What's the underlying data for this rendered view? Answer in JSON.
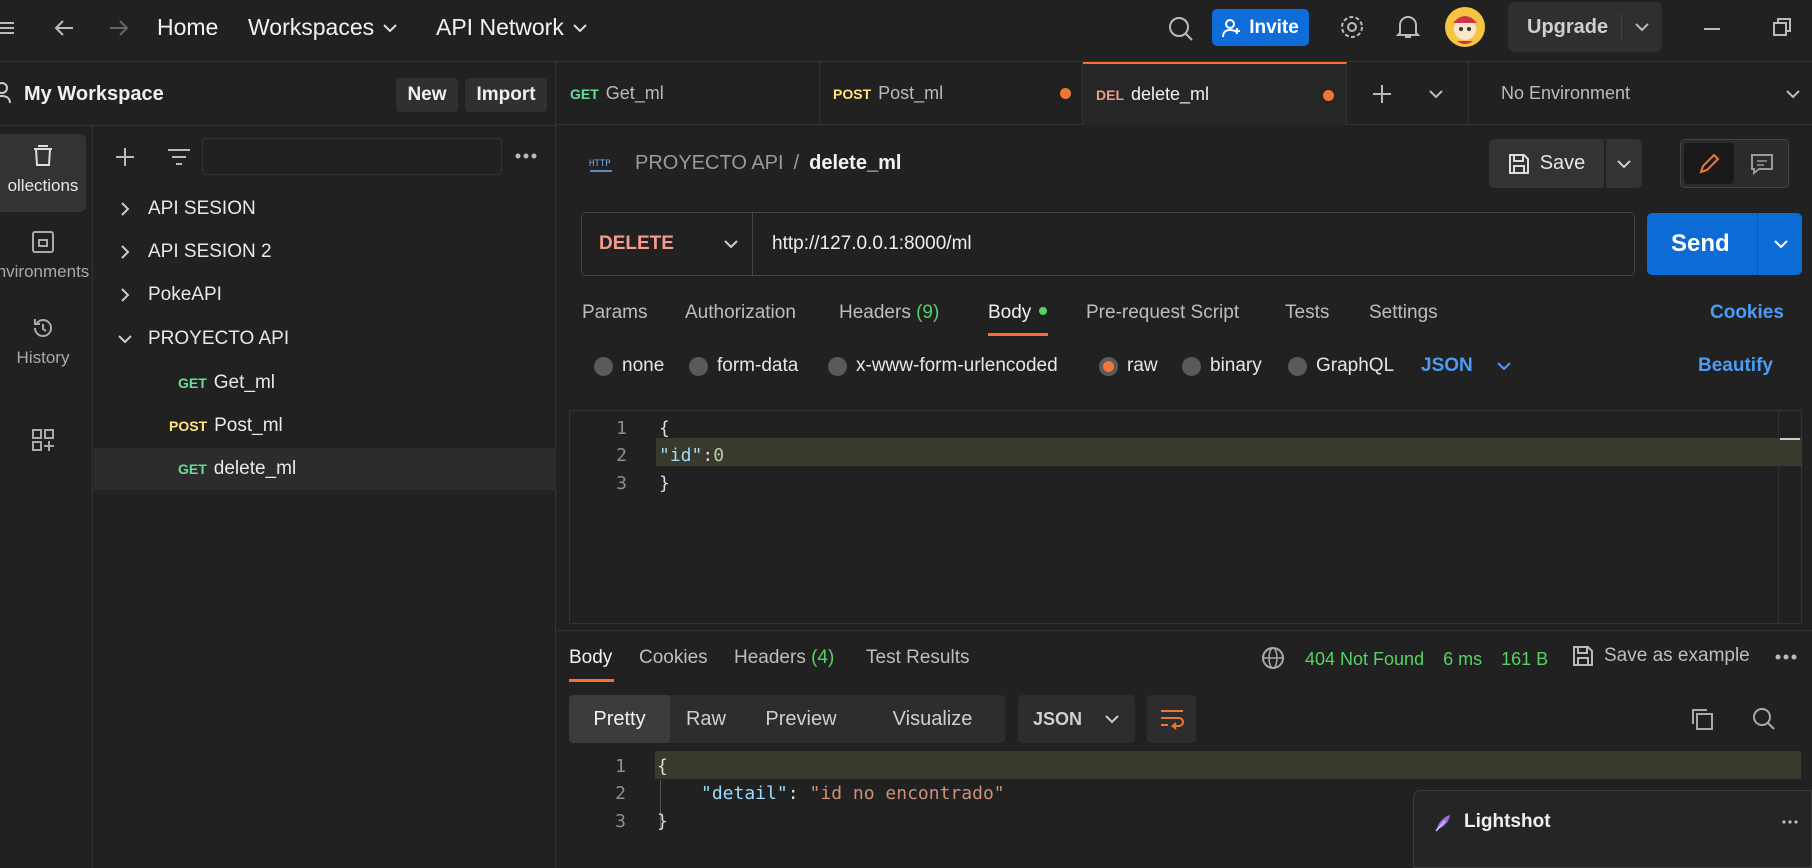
{
  "topbar": {
    "home": "Home",
    "workspaces": "Workspaces",
    "api_network": "API Network",
    "invite": "Invite",
    "upgrade": "Upgrade"
  },
  "workspace": {
    "title": "My Workspace",
    "new": "New",
    "import": "Import"
  },
  "rail": [
    {
      "label": "ollections",
      "icon": "collections-icon"
    },
    {
      "label": "nvironments",
      "icon": "environments-icon"
    },
    {
      "label": "History",
      "icon": "history-icon"
    }
  ],
  "tree": {
    "collections": [
      "API SESION",
      "API SESION 2",
      "PokeAPI",
      "PROYECTO API"
    ],
    "requests": [
      {
        "method": "GET",
        "name": "Get_ml"
      },
      {
        "method": "POST",
        "name": "Post_ml"
      },
      {
        "method": "GET",
        "name": "delete_ml"
      }
    ]
  },
  "tabs": [
    {
      "method": "GET",
      "name": "Get_ml"
    },
    {
      "method": "POST",
      "name": "Post_ml"
    },
    {
      "method": "DEL",
      "name": "delete_ml"
    }
  ],
  "environment": "No Environment",
  "breadcrumb": {
    "collection": "PROYECTO API",
    "separator": "/",
    "request": "delete_ml"
  },
  "save": "Save",
  "request": {
    "method": "DELETE",
    "url": "http://127.0.0.1:8000/ml",
    "send": "Send"
  },
  "req_tabs": {
    "params": "Params",
    "authorization": "Authorization",
    "headers": "Headers",
    "headers_count": "(9)",
    "body": "Body",
    "prerequest": "Pre-request Script",
    "tests": "Tests",
    "settings": "Settings",
    "cookies": "Cookies"
  },
  "body_types": [
    "none",
    "form-data",
    "x-www-form-urlencoded",
    "raw",
    "binary",
    "GraphQL"
  ],
  "body_lang": "JSON",
  "beautify": "Beautify",
  "req_body": {
    "lines": [
      "1",
      "2",
      "3"
    ],
    "l1": "{",
    "l2_key": "\"id\"",
    "l2_colon": ":",
    "l2_val": "0",
    "l3": "}"
  },
  "response": {
    "tabs": {
      "body": "Body",
      "cookies": "Cookies",
      "headers": "Headers",
      "headers_count": "(4)",
      "test_results": "Test Results"
    },
    "status": "404 Not Found",
    "time": "6 ms",
    "size": "161 B",
    "save_example": "Save as example",
    "views": [
      "Pretty",
      "Raw",
      "Preview",
      "Visualize"
    ],
    "format": "JSON",
    "lines": [
      "1",
      "2",
      "3"
    ],
    "l1": "{",
    "l2_key": "\"detail\"",
    "l2_colon": ":",
    "l2_val": "\"id no encontrado\"",
    "l3": "}"
  },
  "lightshot": {
    "title": "Lightshot"
  },
  "colors": {
    "accent": "#ff6c37",
    "get": "#6bdd9a",
    "post": "#ffe47e",
    "del": "#f79a8e",
    "blue": "#0d6bd6",
    "status_ok": "#56d364"
  }
}
